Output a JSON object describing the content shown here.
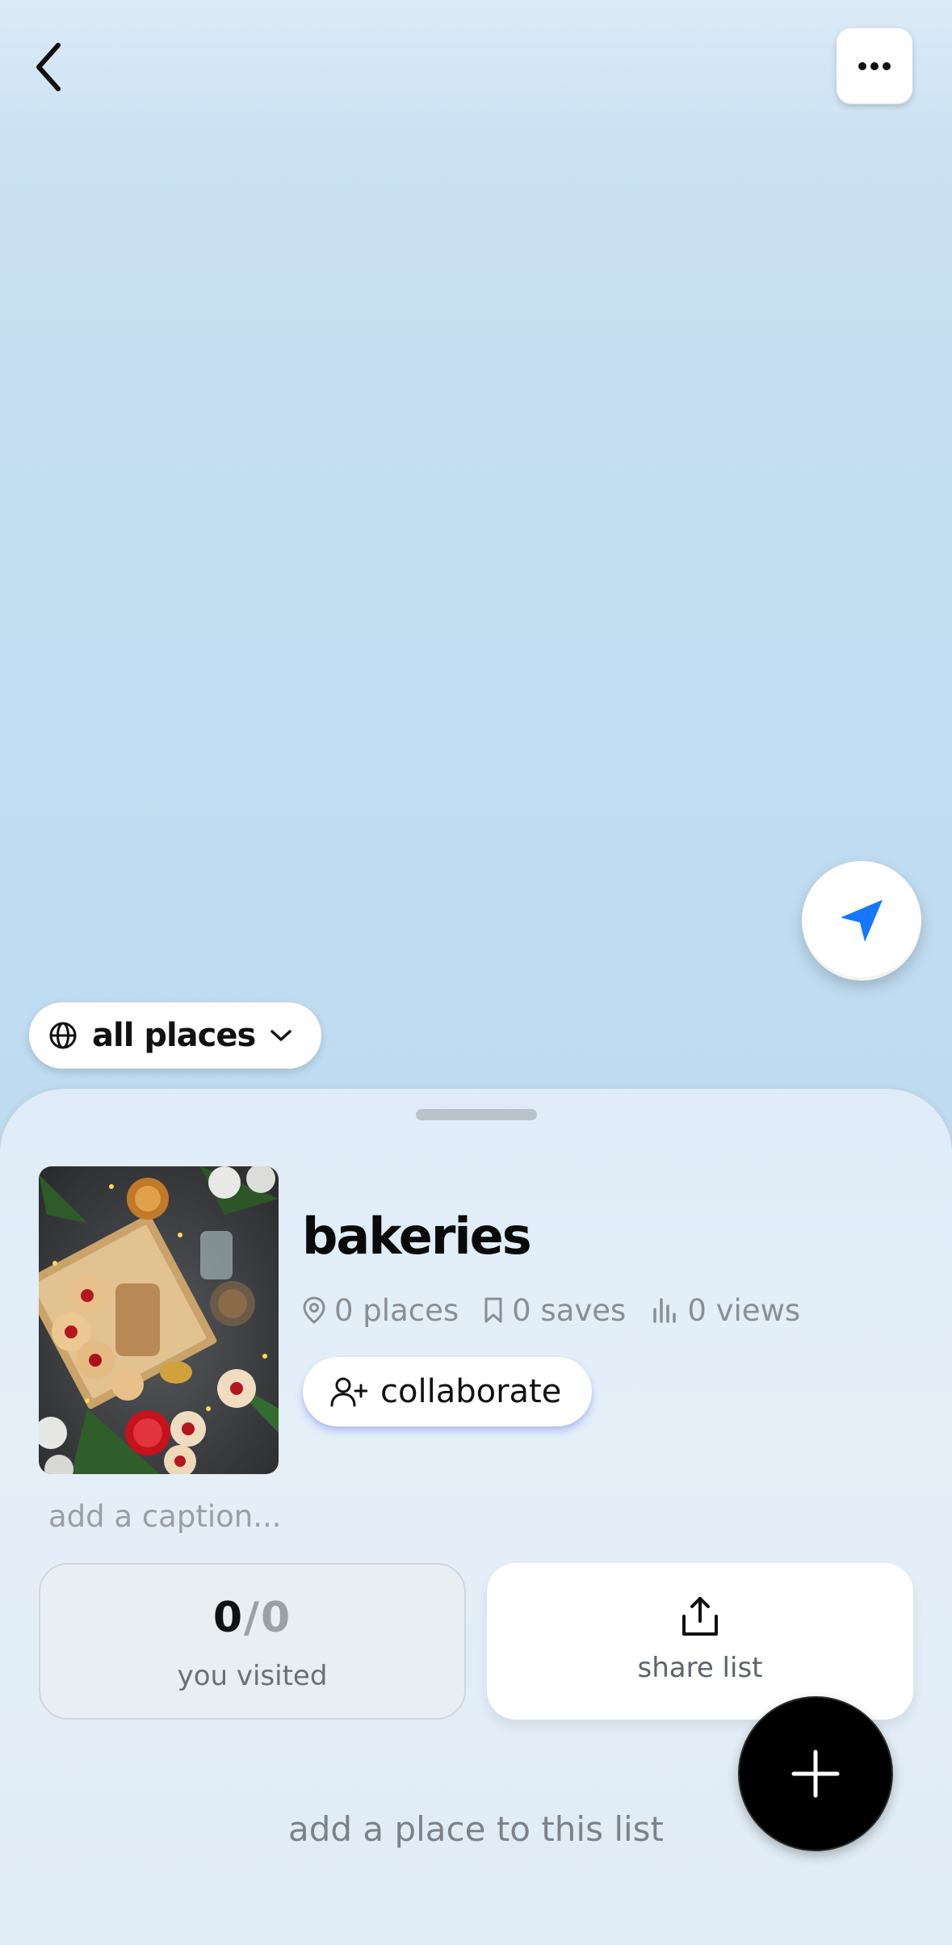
{
  "nav": {
    "back_icon": "chevron-left-icon",
    "more_icon": "ellipsis-icon"
  },
  "map": {
    "locate_icon": "navigation-arrow-icon",
    "locate_color": "#1677ff"
  },
  "filter": {
    "label": "all places",
    "icon": "globe-icon",
    "dropdown_icon": "chevron-down-icon"
  },
  "list": {
    "title": "bakeries",
    "stats": {
      "places": "0 places",
      "saves": "0 saves",
      "views": "0 views"
    },
    "collaborate_label": "collaborate",
    "caption_placeholder": "add a caption..."
  },
  "visited": {
    "count": "0",
    "separator": "/",
    "total": "0",
    "label": "you visited"
  },
  "share": {
    "label": "share list",
    "icon": "share-icon"
  },
  "empty_hint": "add a place to this list",
  "fab": {
    "icon": "plus-icon"
  },
  "colors": {
    "map_background": "#c3ddf1",
    "sheet_background": "#e0ecf6",
    "accent_blue": "#1677ff",
    "fab_background": "#000000"
  }
}
